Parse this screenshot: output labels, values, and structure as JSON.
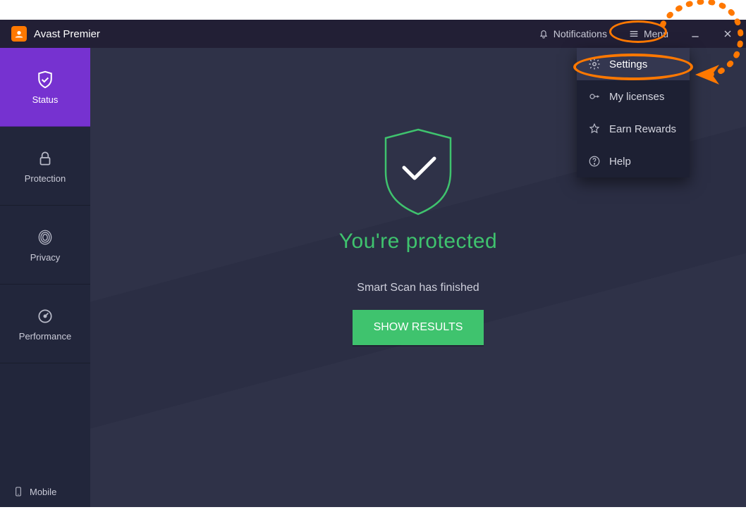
{
  "titlebar": {
    "app_name": "Avast Premier",
    "notifications_label": "Notifications",
    "menu_label": "Menu"
  },
  "sidebar": {
    "items": [
      {
        "label": "Status",
        "active": true
      },
      {
        "label": "Protection",
        "active": false
      },
      {
        "label": "Privacy",
        "active": false
      },
      {
        "label": "Performance",
        "active": false
      }
    ],
    "mobile_label": "Mobile"
  },
  "main": {
    "headline": "You're protected",
    "subline": "Smart Scan has finished",
    "cta_label": "SHOW RESULTS"
  },
  "menu_dropdown": {
    "items": [
      {
        "label": "Settings",
        "icon": "gear-icon",
        "hover": true
      },
      {
        "label": "My licenses",
        "icon": "license-icon"
      },
      {
        "label": "Earn Rewards",
        "icon": "star-icon"
      },
      {
        "label": "Help",
        "icon": "help-icon"
      }
    ]
  },
  "colors": {
    "accent_purple": "#7632d0",
    "accent_green": "#3fc36e",
    "annotation_orange": "#ff7800"
  }
}
